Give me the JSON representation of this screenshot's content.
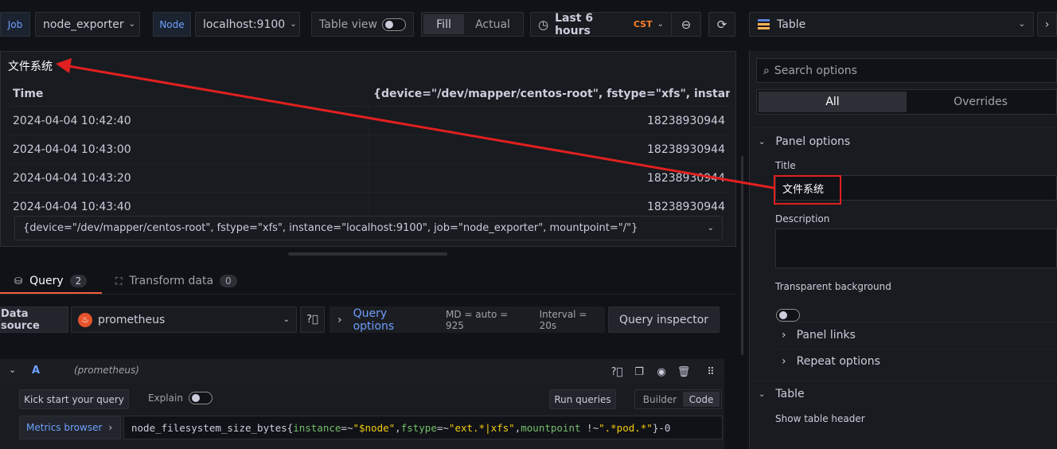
{
  "toolbar": {
    "job_tag": "Job",
    "job_value": "node_exporter",
    "node_tag": "Node",
    "node_value": "localhost:9100",
    "table_view_label": "Table view",
    "fill_label": "Fill",
    "actual_label": "Actual",
    "time_range": "Last 6 hours",
    "timezone": "CST",
    "viz_label": "Table"
  },
  "panel": {
    "title": "文件系统",
    "columns": [
      "Time",
      "{device=\"/dev/mapper/centos-root\", fstype=\"xfs\", instance=\"loca"
    ],
    "rows": [
      {
        "time": "2024-04-04 10:42:40",
        "value": "18238930944"
      },
      {
        "time": "2024-04-04 10:43:00",
        "value": "18238930944"
      },
      {
        "time": "2024-04-04 10:43:20",
        "value": "18238930944"
      },
      {
        "time": "2024-04-04 10:43:40",
        "value": "18238930944"
      }
    ],
    "series_select": "{device=\"/dev/mapper/centos-root\", fstype=\"xfs\", instance=\"localhost:9100\", job=\"node_exporter\", mountpoint=\"/\"}"
  },
  "query_tabs": {
    "query_label": "Query",
    "query_count": "2",
    "transform_label": "Transform data",
    "transform_count": "0"
  },
  "datasource": {
    "label": "Data source",
    "value": "prometheus",
    "query_options": "Query options",
    "md": "MD = auto = 925",
    "interval": "Interval = 20s",
    "inspector": "Query inspector"
  },
  "query_row": {
    "letter": "A",
    "source": "(prometheus)",
    "kick_start": "Kick start your query",
    "explain": "Explain",
    "run_queries": "Run queries",
    "builder": "Builder",
    "code": "Code",
    "metrics_browser": "Metrics browser",
    "expr_metric": "node_filesystem_size_bytes{",
    "expr_l1": "instance",
    "expr_op1": "=~",
    "expr_v1": "\"$node\"",
    "expr_c1": ",",
    "expr_l2": "fstype",
    "expr_op2": "=~",
    "expr_v2": "\"ext.*|xfs\"",
    "expr_c2": ",",
    "expr_l3": "mountpoint",
    "expr_op3": " !~",
    "expr_v3": "\".*pod.*\"",
    "expr_end": "}-0"
  },
  "options": {
    "search_placeholder": "Search options",
    "all_tab": "All",
    "overrides_tab": "Overrides",
    "panel_options": "Panel options",
    "title_label": "Title",
    "title_value": "文件系统",
    "description_label": "Description",
    "transparent_label": "Transparent background",
    "panel_links": "Panel links",
    "repeat_options": "Repeat options",
    "table_section": "Table",
    "show_header": "Show table header"
  },
  "colors": {
    "accent_blue": "#6e9fff",
    "annotation_red": "#e02020",
    "timezone_orange": "#ff7f2a",
    "background": "#111217"
  }
}
